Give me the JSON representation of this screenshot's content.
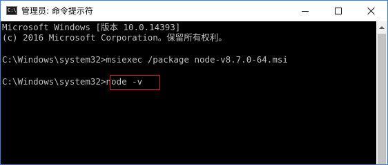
{
  "window": {
    "title": "管理员: 命令提示符",
    "icon_label": "C:\\",
    "minimize_icon": "minimize-icon",
    "maximize_icon": "maximize-icon",
    "close_icon": "close-icon"
  },
  "console": {
    "lines": [
      "Microsoft Windows [版本 10.0.14393]",
      "(c) 2016 Microsoft Corporation。保留所有权利。",
      "C:\\Windows\\system32>msiexec /package node-v8.7.0-64.msi",
      "C:\\Windows\\system32>node -v"
    ],
    "highlight_color": "#e02020",
    "text_color": "#c0c0c0",
    "background_color": "#000000"
  }
}
